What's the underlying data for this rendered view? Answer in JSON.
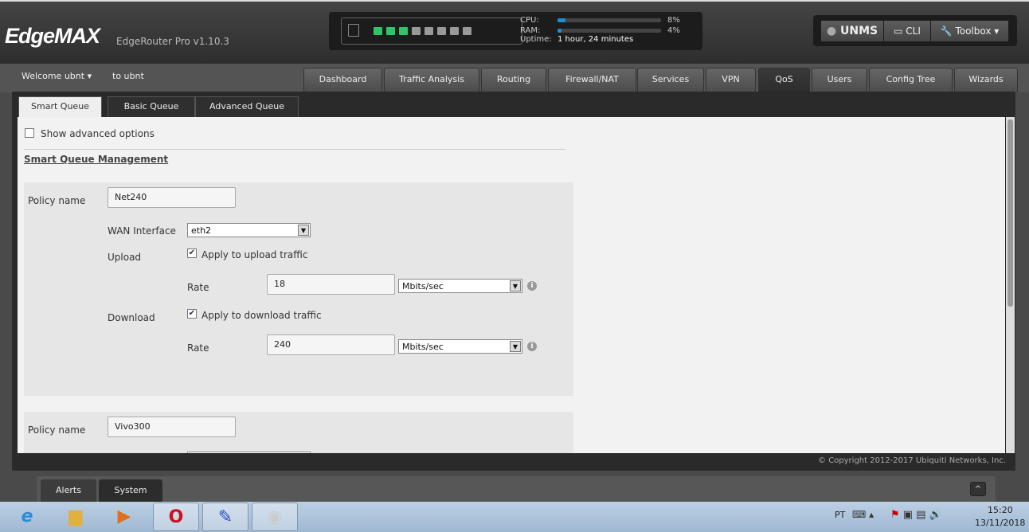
{
  "header": {
    "logo": "EdgeMAX",
    "model": "EdgeRouter Pro v1.10.3",
    "cpu_label": "CPU:",
    "cpu_value": "8%",
    "cpu_percent": 8,
    "ram_label": "RAM:",
    "ram_value": "4%",
    "ram_percent": 4,
    "uptime_label": "Uptime:",
    "uptime_value": "1 hour, 24 minutes",
    "ports": [
      "up",
      "up",
      "up",
      "down",
      "down",
      "down",
      "down",
      "down"
    ],
    "unms": "UNMS",
    "cli": "CLI",
    "toolbox": "Toolbox"
  },
  "nav": {
    "welcome": "Welcome ubnt",
    "to": "to ubnt",
    "tabs": [
      "Dashboard",
      "Traffic Analysis",
      "Routing",
      "Firewall/NAT",
      "Services",
      "VPN",
      "QoS",
      "Users",
      "Config Tree",
      "Wizards"
    ],
    "active": "QoS"
  },
  "subtabs": [
    "Smart Queue",
    "Basic Queue",
    "Advanced Queue"
  ],
  "form": {
    "show_advanced": "Show advanced options",
    "section_title": "Smart Queue Management",
    "policy_label": "Policy name",
    "wan_label": "WAN Interface",
    "upload_label": "Upload",
    "download_label": "Download",
    "rate_label": "Rate",
    "apply_upload": "Apply to upload traffic",
    "apply_download": "Apply to download traffic",
    "policies": [
      {
        "name": "Net240",
        "wan": "eth2",
        "upload_rate": "18",
        "upload_unit": "Mbits/sec",
        "download_rate": "240",
        "download_unit": "Mbits/sec"
      },
      {
        "name": "Vivo300"
      }
    ]
  },
  "footer": {
    "copyright": "© Copyright 2012-2017 Ubiquiti Networks, Inc."
  },
  "bottom": {
    "tabs": [
      "Alerts",
      "System"
    ],
    "collapse": "^"
  },
  "taskbar": {
    "lang": "PT",
    "time": "15:20",
    "date": "13/11/2018"
  }
}
